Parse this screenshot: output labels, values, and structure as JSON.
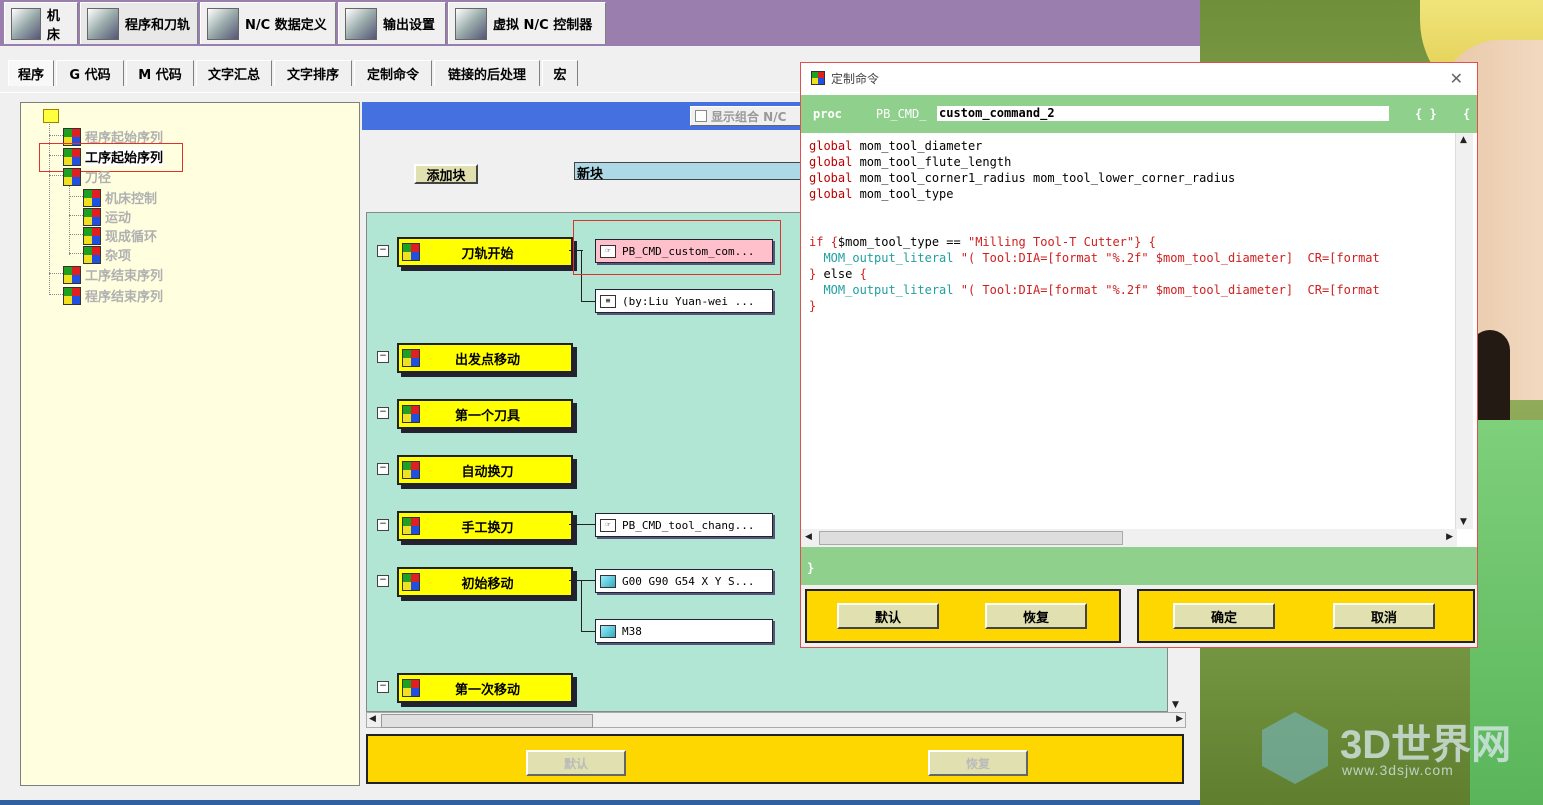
{
  "top_tabs": [
    "机床",
    "程序和刀轨",
    "N/C 数据定义",
    "输出设置",
    "虚拟 N/C 控制器"
  ],
  "sub_tabs": [
    "程序",
    "G 代码",
    "M 代码",
    "文字汇总",
    "文字排序",
    "定制命令",
    "链接的后处理",
    "宏"
  ],
  "tree": {
    "items": [
      "程序起始序列",
      "工序起始序列",
      "刀径",
      "机床控制",
      "运动",
      "现成循环",
      "杂项",
      "工序结束序列",
      "程序结束序列"
    ]
  },
  "work": {
    "combo_label": "显示组合 N/C",
    "add_block": "添加块",
    "new_block": "新块",
    "events": [
      "刀轨开始",
      "出发点移动",
      "第一个刀具",
      "自动换刀",
      "手工换刀",
      "初始移动",
      "第一次移动"
    ],
    "commands": [
      "PB_CMD_custom_com...",
      "(by:Liu Yuan-wei ...",
      "PB_CMD_tool_chang...",
      "G00 G90 G54 X Y S...",
      "M38"
    ],
    "bottom_buttons": [
      "默认",
      "恢复"
    ]
  },
  "dialog": {
    "title": "定制命令",
    "close": "✕",
    "proc_kw": "proc",
    "proc_prefix": "PB_CMD_",
    "proc_name": "custom_command_2",
    "braces": "{ }",
    "brace_open": "{",
    "code": {
      "l1a": "global",
      "l1b": " mom_tool_diameter",
      "l2a": "global",
      "l2b": " mom_tool_flute_length",
      "l3a": "global",
      "l3b": " mom_tool_corner1_radius mom_tool_lower_corner_radius",
      "l4a": "global",
      "l4b": " mom_tool_type",
      "l5a": "if ",
      "l5b": "{",
      "l5c": "$mom_tool_type == ",
      "l5d": "\"Milling Tool-T Cutter\"} {",
      "l6a": "  MOM_output_literal",
      "l6b": " \"( Tool:DIA=[format \"%.2f\" $mom_tool_diameter]  CR=[format",
      "l7a": "} ",
      "l7b": "else",
      "l7c": " {",
      "l8a": "  MOM_output_literal",
      "l8b": " \"( Tool:DIA=[format \"%.2f\" $mom_tool_diameter]  CR=[format",
      "l9": "}"
    },
    "close_brace": "}",
    "buttons": [
      "默认",
      "恢复",
      "确定",
      "取消"
    ]
  },
  "watermark": {
    "text": "3D世界网",
    "url": "www.3dsjw.com"
  }
}
